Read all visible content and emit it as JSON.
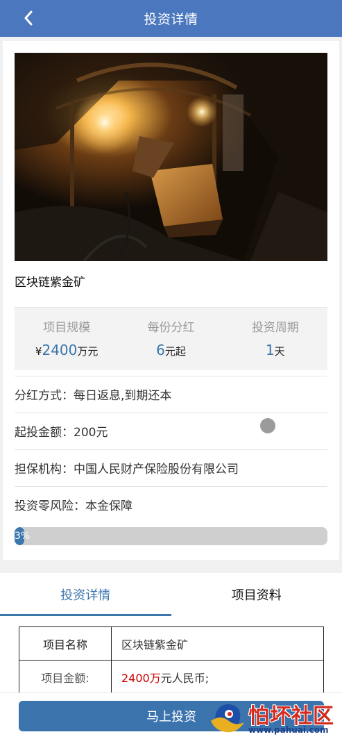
{
  "header": {
    "title": "投资详情"
  },
  "project": {
    "name": "区块链紫金矿"
  },
  "stats": [
    {
      "label": "项目规模",
      "prefix": "¥",
      "value": "2400",
      "suffix": "万元"
    },
    {
      "label": "每份分红",
      "prefix": "",
      "value": "6",
      "suffix": "元起"
    },
    {
      "label": "投资周期",
      "prefix": "",
      "value": "1",
      "suffix": "天"
    }
  ],
  "info": {
    "dividend": "分红方式：每日返息,到期还本",
    "min_invest": "起投金额：200元",
    "guarantor": "担保机构：中国人民财产保险股份有限公司",
    "risk": "投资零风险：本金保障"
  },
  "progress": {
    "percent": 3,
    "label": "3%"
  },
  "tabs": [
    {
      "label": "投资详情",
      "active": true
    },
    {
      "label": "项目资料",
      "active": false
    }
  ],
  "detail_table": {
    "rows": [
      {
        "key": "项目名称",
        "value": "区块链紫金矿"
      },
      {
        "key": "项目金额:",
        "value_red": "2400万",
        "value_rest": "元人民币;"
      }
    ]
  },
  "bottom": {
    "invest_label": "马上投资"
  },
  "watermark": {
    "text": "怕坏社区",
    "url": "www.pahuai.com"
  },
  "colors": {
    "header": "#4a77bd",
    "accent": "#3b76ad",
    "highlight": "#cc0000"
  }
}
